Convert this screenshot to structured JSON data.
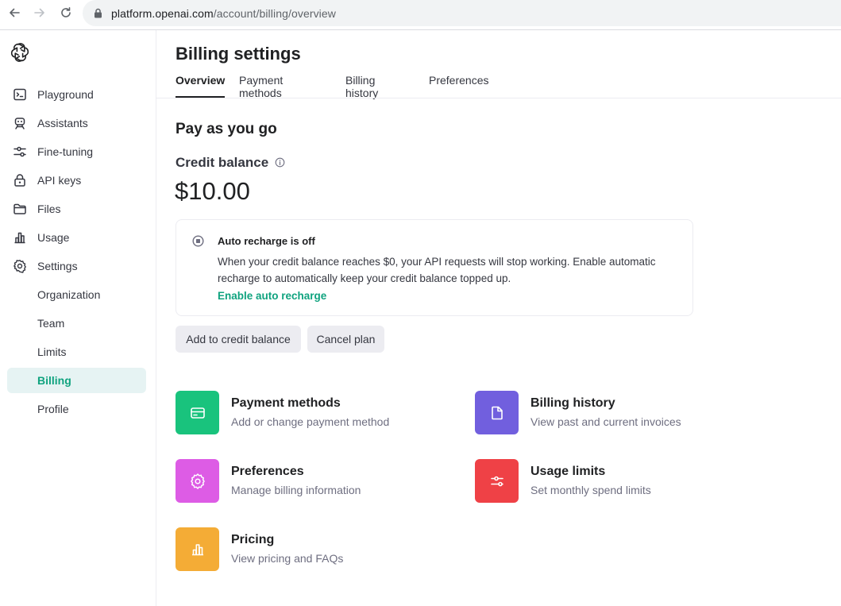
{
  "browser": {
    "url_host": "platform.openai.com",
    "url_path": "/account/billing/overview"
  },
  "sidebar": {
    "items": [
      {
        "label": "Playground",
        "icon": "terminal-icon"
      },
      {
        "label": "Assistants",
        "icon": "robot-icon"
      },
      {
        "label": "Fine-tuning",
        "icon": "sliders-icon"
      },
      {
        "label": "API keys",
        "icon": "lock-icon"
      },
      {
        "label": "Files",
        "icon": "folder-icon"
      },
      {
        "label": "Usage",
        "icon": "bar-chart-icon"
      },
      {
        "label": "Settings",
        "icon": "gear-icon"
      }
    ],
    "sub_items": [
      {
        "label": "Organization"
      },
      {
        "label": "Team"
      },
      {
        "label": "Limits"
      },
      {
        "label": "Billing",
        "active": true
      },
      {
        "label": "Profile"
      }
    ]
  },
  "header": {
    "title": "Billing settings",
    "tabs": [
      {
        "label": "Overview",
        "active": true
      },
      {
        "label": "Payment methods"
      },
      {
        "label": "Billing history"
      },
      {
        "label": "Preferences"
      }
    ]
  },
  "overview": {
    "plan_title": "Pay as you go",
    "credit_label": "Credit balance",
    "credit_amount": "$10.00",
    "recharge": {
      "title": "Auto recharge is off",
      "description": "When your credit balance reaches $0, your API requests will stop working. Enable automatic recharge to automatically keep your credit balance topped up.",
      "link": "Enable auto recharge"
    },
    "buttons": {
      "add_credit": "Add to credit balance",
      "cancel_plan": "Cancel plan"
    }
  },
  "tiles": [
    {
      "title": "Payment methods",
      "subtitle": "Add or change payment method",
      "icon": "credit-card-icon",
      "color": "#19c37d"
    },
    {
      "title": "Billing history",
      "subtitle": "View past and current invoices",
      "icon": "document-icon",
      "color": "#715fde"
    },
    {
      "title": "Preferences",
      "subtitle": "Manage billing information",
      "icon": "gear-icon",
      "color": "#dd5ce5"
    },
    {
      "title": "Usage limits",
      "subtitle": "Set monthly spend limits",
      "icon": "sliders-icon",
      "color": "#ef4146"
    },
    {
      "title": "Pricing",
      "subtitle": "View pricing and FAQs",
      "icon": "bar-chart-icon",
      "color": "#f4ac36"
    }
  ],
  "colors": {
    "accent": "#10a37f",
    "active_bg": "#e6f3f3",
    "button_bg": "#ececf1"
  }
}
